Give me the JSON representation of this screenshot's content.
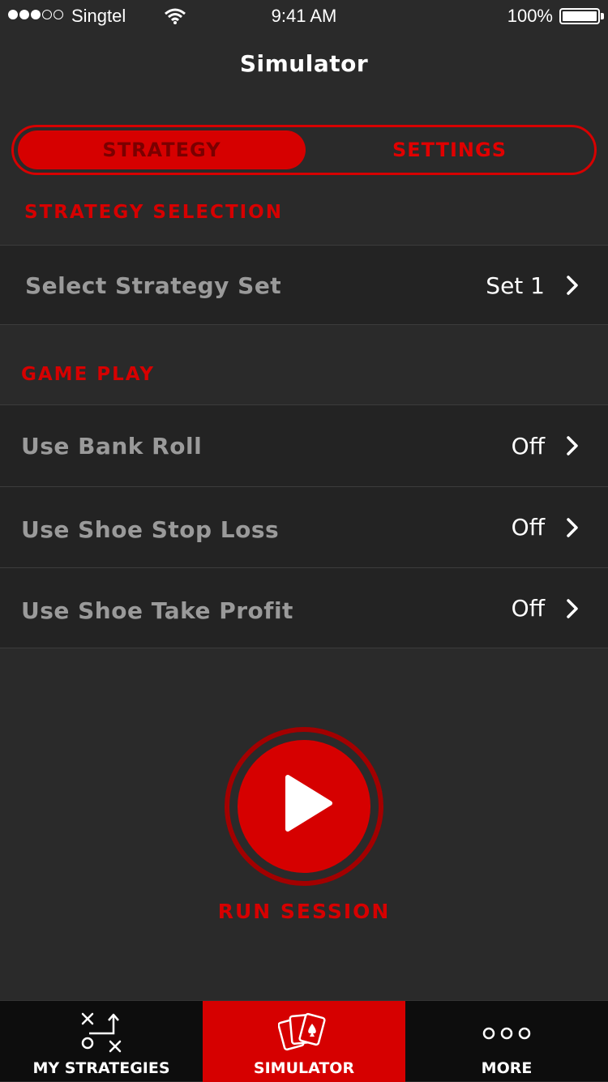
{
  "status_bar": {
    "carrier": "Singtel",
    "time": "9:41 AM",
    "battery": "100%",
    "signal_strength": 3,
    "signal_max": 5
  },
  "nav": {
    "title": "Simulator"
  },
  "segmented_control": {
    "tabs": [
      {
        "label": "STRATEGY",
        "active": true
      },
      {
        "label": "SETTINGS",
        "active": false
      }
    ]
  },
  "strategy_selection": {
    "header": "STRATEGY SELECTION",
    "rows": [
      {
        "label": "Select Strategy Set",
        "value": "Set 1"
      }
    ]
  },
  "game_play": {
    "header": "GAME PLAY",
    "rows": [
      {
        "label": "Use Bank Roll",
        "value": "Off"
      },
      {
        "label": "Use Shoe Stop Loss",
        "value": "Off"
      },
      {
        "label": "Use Shoe Take Profit",
        "value": "Off"
      }
    ]
  },
  "run": {
    "label": "RUN SESSION",
    "icon": "play-icon"
  },
  "tab_bar": {
    "items": [
      {
        "label": "MY STRATEGIES",
        "icon": "playbook-icon",
        "active": false
      },
      {
        "label": "SIMULATOR",
        "icon": "cards-icon",
        "active": true
      },
      {
        "label": "MORE",
        "icon": "more-dots-icon",
        "active": false
      }
    ]
  },
  "colors": {
    "accent": "#d60000",
    "background": "#2a2a2a",
    "row": "#232323",
    "tabbar": "#0d0d0d"
  }
}
